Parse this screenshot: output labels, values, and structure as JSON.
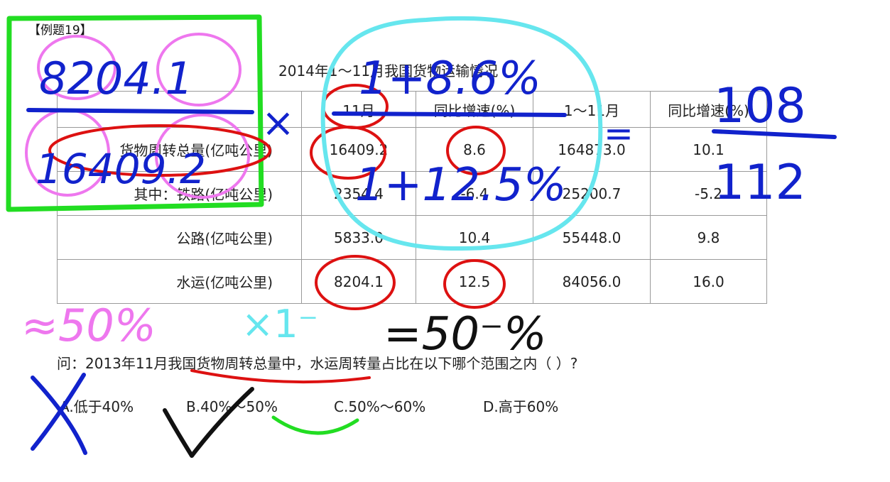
{
  "example_tag": "【例题19】",
  "table_title": "2014年1～11月我国货物运输情况",
  "header": [
    "",
    "11月",
    "同比增速(%)",
    "1～11月",
    "同比增速(%)"
  ],
  "rows": [
    {
      "label": "货物周转总量(亿吨公里)",
      "m11": "16409.2",
      "g1": "8.6",
      "ytd": "164873.0",
      "g2": "10.1"
    },
    {
      "label": "其中：铁路(亿吨公里)",
      "m11": "2354.4",
      "g1": "-6.4",
      "ytd": "25200.7",
      "g2": "-5.2"
    },
    {
      "label": "公路(亿吨公里)",
      "m11": "5833.0",
      "g1": "10.4",
      "ytd": "55448.0",
      "g2": "9.8"
    },
    {
      "label": "水运(亿吨公里)",
      "m11": "8204.1",
      "g1": "12.5",
      "ytd": "84056.0",
      "g2": "16.0"
    }
  ],
  "question": "问：2013年11月我国货物周转总量中，水运周转量占比在以下哪个范围之内（ ）?",
  "options": [
    "A.低于40%",
    "B.40%～50%",
    "C.50%～60%",
    "D.高于60%"
  ],
  "annotations": {
    "numerator": "8204.1",
    "denominator": "16409.2",
    "times": "×",
    "fraction_top": "1+8.6%",
    "fraction_bottom": "1+12.5%",
    "equals": "=",
    "result_top": "108",
    "result_bottom": "112",
    "approx_left": "≈50%",
    "times_less_than_one": "×1⁻",
    "approx_right": "=50⁻%"
  },
  "ink_colors": {
    "green": "#22dd22",
    "pink": "#ee77ee",
    "blue": "#1122cc",
    "red": "#dd1111",
    "cyan": "#66e6ee",
    "black": "#111111"
  }
}
